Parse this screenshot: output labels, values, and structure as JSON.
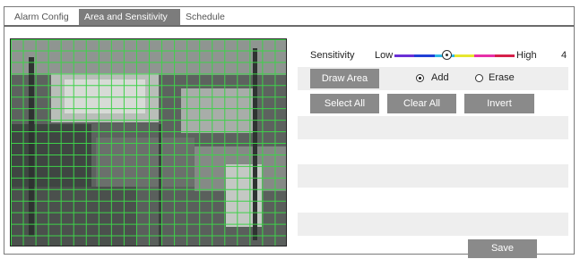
{
  "tabs": [
    {
      "label": "Alarm Config",
      "active": false
    },
    {
      "label": "Area and Sensitivity",
      "active": true
    },
    {
      "label": "Schedule",
      "active": false
    }
  ],
  "sensitivity": {
    "label": "Sensitivity",
    "low_label": "Low",
    "high_label": "High",
    "value": "4",
    "track_colors": [
      "#6a2fd6",
      "#1f3fd6",
      "#2fb8e6",
      "#e6e62f",
      "#e62fa8",
      "#d61f4a"
    ]
  },
  "draw_area_button": "Draw Area",
  "mode_options": {
    "add_label": "Add",
    "erase_label": "Erase",
    "selected": "Add"
  },
  "buttons": {
    "select_all": "Select All",
    "clear_all": "Clear All",
    "invert": "Invert",
    "save": "Save"
  },
  "colors": {
    "grid": "#3fd14a",
    "button": "#8a8a8a",
    "active_tab": "#7c7c7c"
  }
}
